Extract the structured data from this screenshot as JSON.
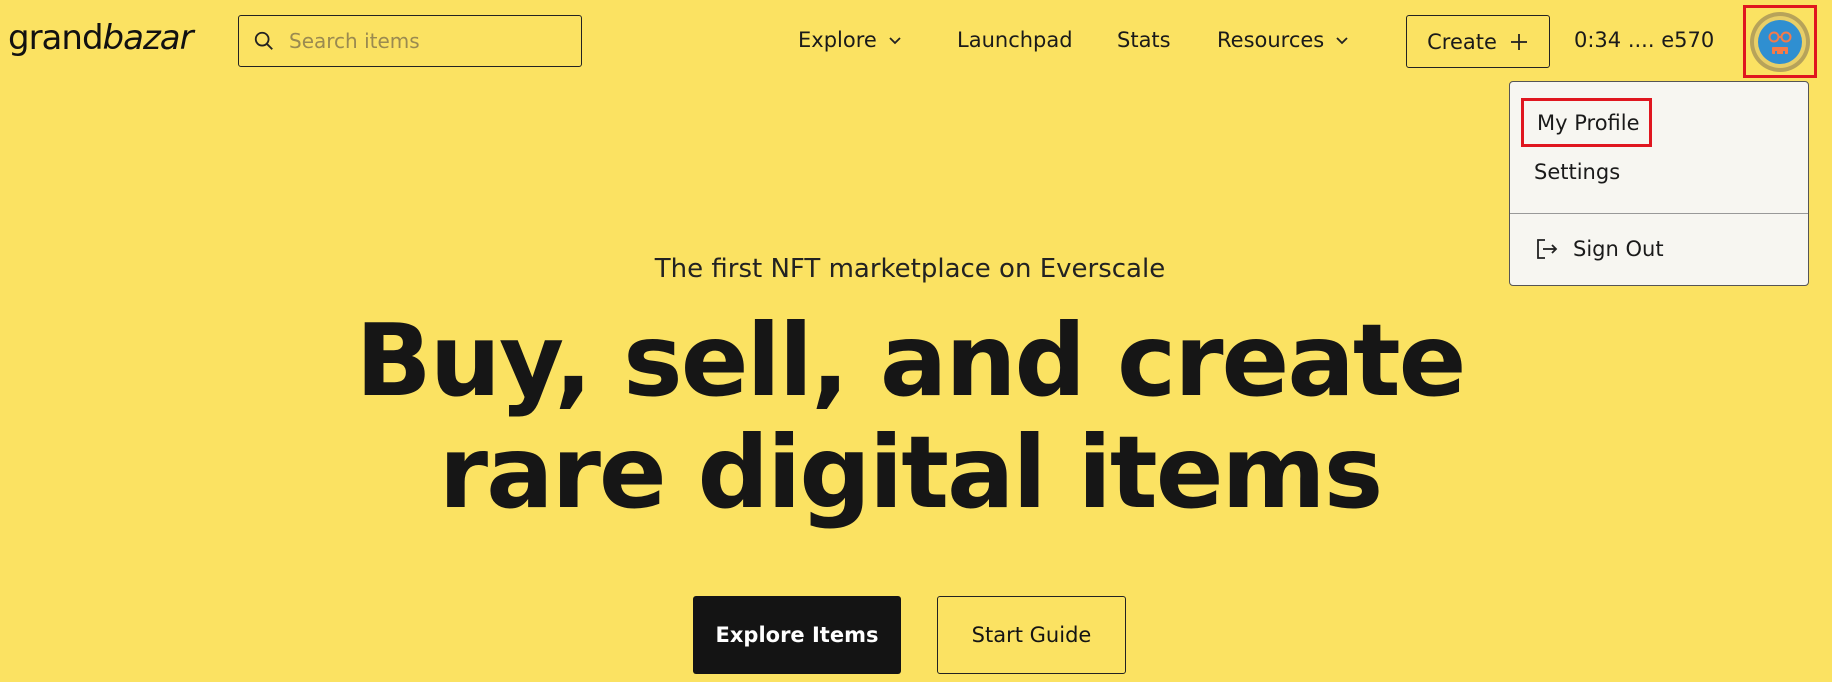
{
  "header": {
    "logo_part1": "grand",
    "logo_part2": "bazar",
    "search_placeholder": "Search items",
    "nav": {
      "explore": "Explore",
      "launchpad": "Launchpad",
      "stats": "Stats",
      "resources": "Resources"
    },
    "create_label": "Create",
    "wallet_address": "0:34 .... e570"
  },
  "profile_menu": {
    "my_profile": "My Profile",
    "settings": "Settings",
    "sign_out": "Sign Out"
  },
  "hero": {
    "tagline": "The first NFT marketplace on Everscale",
    "headline_line1": "Buy, sell, and create",
    "headline_line2": "rare digital items",
    "primary_button": "Explore Items",
    "secondary_button": "Start Guide"
  },
  "colors": {
    "background": "#fbe262",
    "highlight": "#e0161f",
    "primary_button": "#141414"
  },
  "icons": {
    "search": "search-icon",
    "chevron": "chevron-down-icon",
    "plus": "plus-icon",
    "avatar": "avatar-icon",
    "sign_out": "sign-out-icon"
  }
}
